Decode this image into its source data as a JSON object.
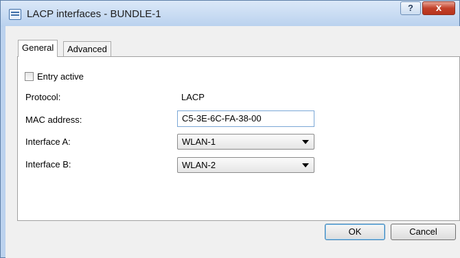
{
  "window": {
    "title": "LACP interfaces - BUNDLE-1",
    "help_label": "?",
    "close_label": "x"
  },
  "tabs": [
    {
      "label": "General",
      "active": true
    },
    {
      "label": "Advanced",
      "active": false
    }
  ],
  "form": {
    "entry_active": {
      "label": "Entry active",
      "checked": false
    },
    "protocol": {
      "label": "Protocol:",
      "value": "LACP"
    },
    "mac_address": {
      "label": "MAC address:",
      "value": "C5-3E-6C-FA-38-00"
    },
    "interface_a": {
      "label": "Interface A:",
      "value": "WLAN-1"
    },
    "interface_b": {
      "label": "Interface B:",
      "value": "WLAN-2"
    }
  },
  "buttons": {
    "ok": "OK",
    "cancel": "Cancel"
  }
}
